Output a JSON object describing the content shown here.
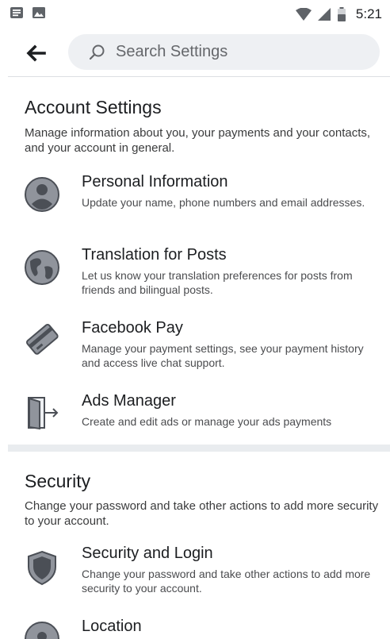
{
  "status_bar": {
    "time": "5:21"
  },
  "search": {
    "placeholder": "Search Settings"
  },
  "account_settings": {
    "title": "Account Settings",
    "description": "Manage information about you, your payments and your contacts, and your account in general.",
    "items": [
      {
        "title": "Personal Information",
        "description": "Update your name, phone numbers and email addresses.",
        "icon": "person-icon"
      },
      {
        "title": "Translation for Posts",
        "description": "Let us know your translation preferences for posts from friends and bilingual posts.",
        "icon": "globe-icon"
      },
      {
        "title": "Facebook Pay",
        "description": "Manage your payment settings, see your payment history and access live chat support.",
        "icon": "credit-card-icon"
      },
      {
        "title": "Ads Manager",
        "description": "Create and edit ads or manage your ads payments",
        "icon": "door-arrow-icon"
      }
    ]
  },
  "security": {
    "title": "Security",
    "description": "Change your password and take other actions to add more security to your account.",
    "items": [
      {
        "title": "Security and Login",
        "description": "Change your password and take other actions to add more security to your account.",
        "icon": "shield-icon"
      },
      {
        "title": "Location",
        "description": "",
        "icon": "location-pin-icon"
      }
    ]
  },
  "colors": {
    "icon_fill": "#90949c",
    "icon_dark": "#4b4f56",
    "search_bg": "#eef0f3"
  }
}
